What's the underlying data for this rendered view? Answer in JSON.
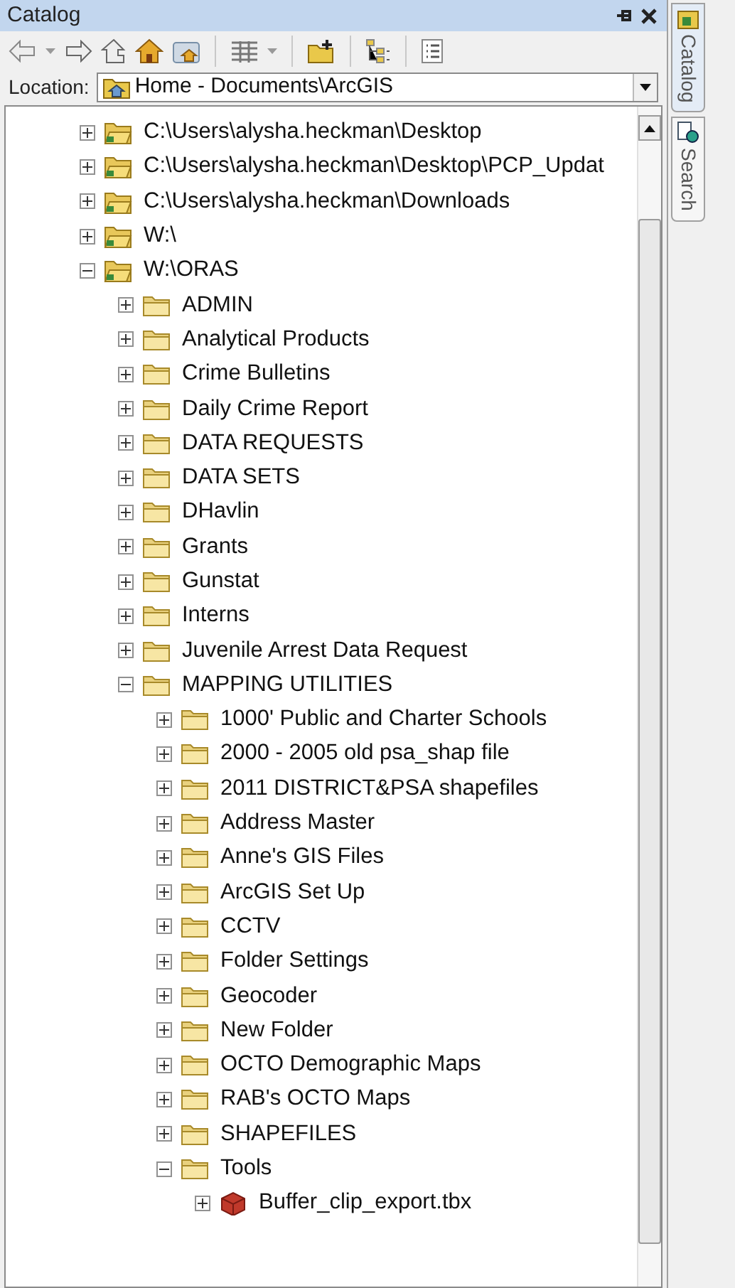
{
  "window": {
    "title": "Catalog"
  },
  "location": {
    "label": "Location:",
    "value": "Home - Documents\\ArcGIS"
  },
  "side_tabs": [
    {
      "label": "Catalog",
      "kind": "catalog",
      "selected": true
    },
    {
      "label": "Search",
      "kind": "search",
      "selected": false
    }
  ],
  "tree": [
    {
      "label": "C:\\Users\\alysha.heckman\\Desktop",
      "kind": "connection",
      "expanded": false
    },
    {
      "label": "C:\\Users\\alysha.heckman\\Desktop\\PCP_Updat",
      "kind": "connection",
      "expanded": false
    },
    {
      "label": "C:\\Users\\alysha.heckman\\Downloads",
      "kind": "connection",
      "expanded": false
    },
    {
      "label": "W:\\",
      "kind": "connection",
      "expanded": false
    },
    {
      "label": "W:\\ORAS",
      "kind": "connection",
      "expanded": true,
      "children": [
        {
          "label": "ADMIN",
          "kind": "folder",
          "expanded": false
        },
        {
          "label": "Analytical Products",
          "kind": "folder",
          "expanded": false
        },
        {
          "label": "Crime Bulletins",
          "kind": "folder",
          "expanded": false
        },
        {
          "label": "Daily Crime Report",
          "kind": "folder",
          "expanded": false
        },
        {
          "label": "DATA REQUESTS",
          "kind": "folder",
          "expanded": false
        },
        {
          "label": "DATA SETS",
          "kind": "folder",
          "expanded": false
        },
        {
          "label": "DHavlin",
          "kind": "folder",
          "expanded": false
        },
        {
          "label": "Grants",
          "kind": "folder",
          "expanded": false
        },
        {
          "label": "Gunstat",
          "kind": "folder",
          "expanded": false
        },
        {
          "label": "Interns",
          "kind": "folder",
          "expanded": false
        },
        {
          "label": "Juvenile Arrest Data Request",
          "kind": "folder",
          "expanded": false
        },
        {
          "label": "MAPPING UTILITIES",
          "kind": "folder",
          "expanded": true,
          "children": [
            {
              "label": "1000' Public and Charter Schools",
              "kind": "folder",
              "expanded": false
            },
            {
              "label": "2000 - 2005 old psa_shap file",
              "kind": "folder",
              "expanded": false
            },
            {
              "label": "2011 DISTRICT&PSA shapefiles",
              "kind": "folder",
              "expanded": false
            },
            {
              "label": "Address Master",
              "kind": "folder",
              "expanded": false
            },
            {
              "label": "Anne's GIS Files",
              "kind": "folder",
              "expanded": false
            },
            {
              "label": "ArcGIS Set Up",
              "kind": "folder",
              "expanded": false
            },
            {
              "label": "CCTV",
              "kind": "folder",
              "expanded": false
            },
            {
              "label": "Folder Settings",
              "kind": "folder",
              "expanded": false
            },
            {
              "label": "Geocoder",
              "kind": "folder",
              "expanded": false
            },
            {
              "label": "New Folder",
              "kind": "folder",
              "expanded": false
            },
            {
              "label": "OCTO Demographic Maps",
              "kind": "folder",
              "expanded": false
            },
            {
              "label": "RAB's OCTO Maps",
              "kind": "folder",
              "expanded": false
            },
            {
              "label": "SHAPEFILES",
              "kind": "folder",
              "expanded": false
            },
            {
              "label": "Tools",
              "kind": "folder",
              "expanded": true,
              "children": [
                {
                  "label": "Buffer_clip_export.tbx",
                  "kind": "toolbox",
                  "expanded": false
                }
              ]
            }
          ]
        }
      ]
    }
  ]
}
